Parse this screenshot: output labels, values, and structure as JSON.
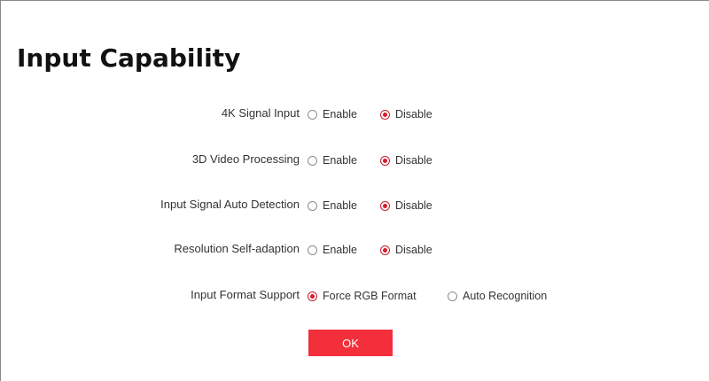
{
  "page": {
    "title": "Input Capability"
  },
  "settings": [
    {
      "label": "4K Signal Input",
      "options": [
        {
          "label": "Enable",
          "checked": false
        },
        {
          "label": "Disable",
          "checked": true
        }
      ]
    },
    {
      "label": "3D Video Processing",
      "options": [
        {
          "label": "Enable",
          "checked": false
        },
        {
          "label": "Disable",
          "checked": true
        }
      ]
    },
    {
      "label": "Input Signal Auto Detection",
      "options": [
        {
          "label": "Enable",
          "checked": false
        },
        {
          "label": "Disable",
          "checked": true
        }
      ]
    },
    {
      "label": "Resolution Self-adaption",
      "options": [
        {
          "label": "Enable",
          "checked": false
        },
        {
          "label": "Disable",
          "checked": true
        }
      ]
    },
    {
      "label": "Input Format Support",
      "options": [
        {
          "label": "Force RGB Format",
          "checked": true
        },
        {
          "label": "Auto Recognition",
          "checked": false
        }
      ]
    }
  ],
  "actions": {
    "ok_label": "OK"
  },
  "colors": {
    "accent": "#f22f3a",
    "radio_checked": "#d7192a"
  }
}
